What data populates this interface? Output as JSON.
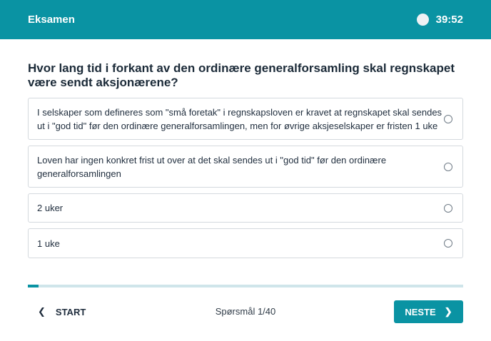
{
  "header": {
    "title": "Eksamen",
    "timer": "39:52"
  },
  "question": {
    "text": "Hvor lang tid i forkant av den ordinære generalforsamling skal regnskapet være sendt aksjonærene?"
  },
  "options": [
    {
      "label": "I selskaper som defineres som \"små foretak\" i regnskapsloven er kravet at regnskapet skal sendes ut i \"god tid\" før den ordinære generalforsamlingen, men for øvrige aksjeselskaper er fristen 1 uke",
      "selected": false
    },
    {
      "label": "Loven har ingen konkret frist ut over at det skal sendes ut i \"god tid\" før den ordinære generalforsamlingen",
      "selected": false
    },
    {
      "label": "2 uker",
      "selected": false
    },
    {
      "label": "1 uke",
      "selected": false
    }
  ],
  "progress": {
    "current": 1,
    "total": 40,
    "fraction": 0.025
  },
  "footer": {
    "start_label": "START",
    "counter": "Spørsmål 1/40",
    "next_label": "NESTE"
  },
  "colors": {
    "accent": "#0a93a3",
    "track": "#cfe5ea"
  }
}
